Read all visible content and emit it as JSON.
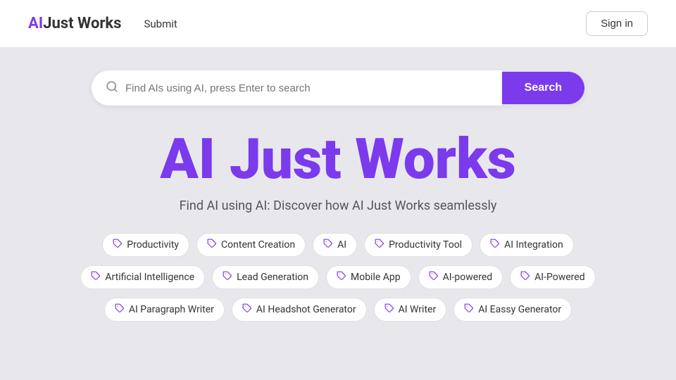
{
  "header": {
    "logo": "AIJust Works",
    "logo_ai": "AI",
    "logo_rest": "Just Works",
    "nav_submit": "Submit",
    "sign_in": "Sign in"
  },
  "search": {
    "placeholder": "Find AIs using AI, press Enter to search",
    "button_label": "Search"
  },
  "hero": {
    "title": "AI Just Works",
    "subtitle": "Find AI using AI: Discover how AI Just Works seamlessly"
  },
  "tags_row1": [
    {
      "label": "Productivity"
    },
    {
      "label": "Content Creation"
    },
    {
      "label": "AI"
    },
    {
      "label": "Productivity Tool"
    },
    {
      "label": "AI Integration"
    }
  ],
  "tags_row2": [
    {
      "label": "Artificial Intelligence"
    },
    {
      "label": "Lead Generation"
    },
    {
      "label": "Mobile App"
    },
    {
      "label": "AI-powered"
    },
    {
      "label": "AI-Powered"
    }
  ],
  "tags_row3": [
    {
      "label": "AI Paragraph Writer"
    },
    {
      "label": "AI Headshot Generator"
    },
    {
      "label": "AI Writer"
    },
    {
      "label": "AI Eassy Generator"
    }
  ]
}
